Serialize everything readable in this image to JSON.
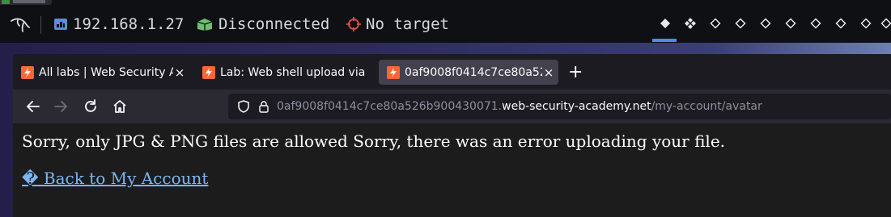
{
  "panel": {
    "ip_address": "192.168.1.27",
    "vpn_status": "Disconnected",
    "target": "No target",
    "workspace_count": 10,
    "active_workspace": 1,
    "ip_icon": "network-icon",
    "vpn_icon": "vpn-box-icon",
    "target_icon": "crosshair-icon"
  },
  "browser": {
    "tabs": [
      {
        "title": "All labs | Web Security Ac",
        "favicon": "portswigger-icon",
        "active": false
      },
      {
        "title": "Lab: Web shell upload via",
        "favicon": "portswigger-icon",
        "active": false
      },
      {
        "title": "0af9008f0414c7ce80a52",
        "favicon": "portswigger-icon",
        "active": true
      }
    ],
    "new_tab_label": "+",
    "close_glyph": "×",
    "url": {
      "prefix": "0af9008f0414c7ce80a526b900430071.",
      "domain": "web-security-academy.net",
      "path": "/my-account/avatar"
    }
  },
  "page": {
    "message": "Sorry, only JPG & PNG files are allowed Sorry, there was an error uploading your file.",
    "back_link": "� Back to My Account"
  },
  "colors": {
    "accent": "#4d8bf0",
    "link": "#7cb6f2",
    "favicon": "#ff6633"
  }
}
